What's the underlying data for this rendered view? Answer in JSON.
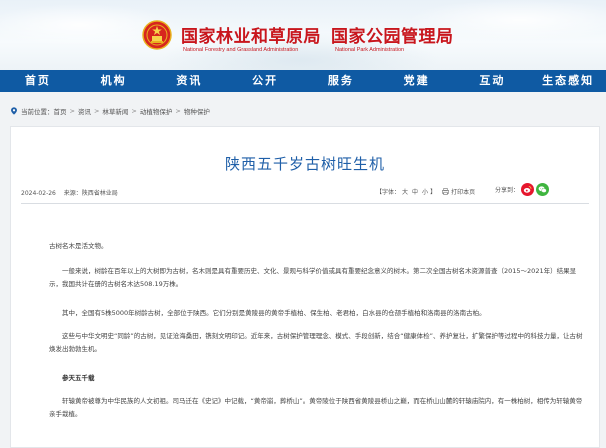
{
  "header": {
    "title_cn_1": "国家林业和草原局",
    "title_cn_2": "国家公园管理局",
    "title_en_1": "National Forestry and Grassland Administration",
    "title_en_2": "National Park Administration"
  },
  "nav": {
    "items": [
      "首页",
      "机构",
      "资讯",
      "公开",
      "服务",
      "党建",
      "互动",
      "生态感知"
    ]
  },
  "breadcrumb": {
    "prefix": "当前位置：",
    "items": [
      "首页",
      "资讯",
      "林草新闻",
      "动植物保护",
      "物种保护"
    ]
  },
  "article": {
    "title": "陕西五千岁古树旺生机",
    "date": "2024-02-26",
    "source": "来源：陕西省林业局",
    "font_label": "【字体：",
    "font_sizes": [
      "大",
      "中",
      "小"
    ],
    "font_close": "】",
    "print_label": "打印本页",
    "share_label": "分享到：",
    "paragraphs": [
      "古树名木是活文物。",
      "一般来说，树龄在百年以上的大树即为古树，名木则是具有重要历史、文化、景观与科学价值或具有重要纪念意义的树木。第二次全国古树名木资源普查（2015～2021年）结果显示，我国共计在册的古树名木达508.19万株。",
      "其中，全国有5株5000年树龄古树，全部位于陕西。它们分别是黄陵县的黄帝手植柏、保生柏、老君柏，白水县的仓颉手植柏和洛南县的洛南古柏。",
      "这些与中华文明史“同龄”的古树，见证沧海桑田，镌刻文明印记。近年来，古树保护管理理念、模式、手段创新，结合“健康体检”、养护复壮，扩繁保护等过程中的科技力量，让古树焕发出勃勃生机。",
      "参天五千载",
      "轩辕黄帝被尊为中华民族的人文初祖。司马迁在《史记》中记载，“黄帝崩，葬桥山”。黄帝陵位于陕西省黄陵县桥山之巅，而在桥山山麓的轩辕庙院内，有一株柏树，相传为轩辕黄帝亲手栽植。"
    ]
  },
  "colors": {
    "brand_red": "#c8161d",
    "nav_blue": "#0f5aa3",
    "title_blue": "#1f5fa8",
    "weibo_red": "#e6162d",
    "wechat_green": "#3fb53f"
  },
  "icons": {
    "emblem": "national-emblem-icon",
    "breadcrumb": "location-pin-icon",
    "print": "print-icon",
    "weibo": "weibo-icon",
    "wechat": "wechat-icon"
  }
}
